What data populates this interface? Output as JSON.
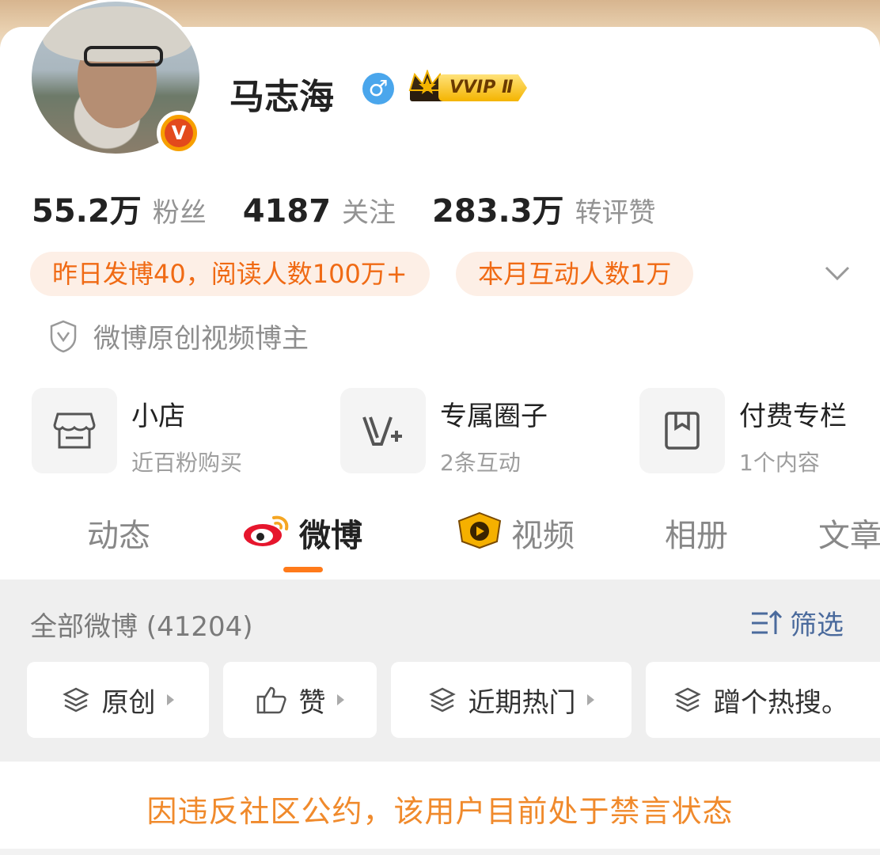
{
  "profile": {
    "name": "马志海",
    "gender_icon": "male-icon",
    "gender_symbol": "♂",
    "vip_badge": "VVIP Ⅱ",
    "verified_badge": "V"
  },
  "stats": [
    {
      "value": "55.2万",
      "label": "粉丝"
    },
    {
      "value": "4187",
      "label": "关注"
    },
    {
      "value": "283.3万",
      "label": "转评赞"
    }
  ],
  "highlights": {
    "pill1": "昨日发博40，阅读人数100万+",
    "pill2": "本月互动人数1万"
  },
  "certification": "微博原创视频博主",
  "features": [
    {
      "title": "小店",
      "subtitle": "近百粉购买",
      "icon": "shop-icon"
    },
    {
      "title": "专属圈子",
      "subtitle": "2条互动",
      "icon": "circle-v-icon"
    },
    {
      "title": "付费专栏",
      "subtitle": "1个内容",
      "icon": "bookmark-icon"
    }
  ],
  "tabs": [
    {
      "label": "动态",
      "active": false
    },
    {
      "label": "微博",
      "active": true
    },
    {
      "label": "视频",
      "active": false
    },
    {
      "label": "相册",
      "active": false
    },
    {
      "label": "文章",
      "active": false
    }
  ],
  "feed": {
    "all_label": "全部微博 (41204)",
    "filter_label": "筛选",
    "chips": [
      {
        "label": "原创",
        "icon": "layers-icon"
      },
      {
        "label": "赞",
        "icon": "thumbs-up-icon"
      },
      {
        "label": "近期热门",
        "icon": "layers-icon"
      },
      {
        "label": "蹭个热搜。",
        "icon": "layers-icon"
      }
    ]
  },
  "notice": "因违反社区公约，该用户目前处于禁言状态",
  "colors": {
    "accent": "#ff7a1a",
    "pill_bg": "#fdefe6",
    "pill_text": "#f06a14",
    "notice": "#f08a2c",
    "link": "#4a6a9c"
  }
}
